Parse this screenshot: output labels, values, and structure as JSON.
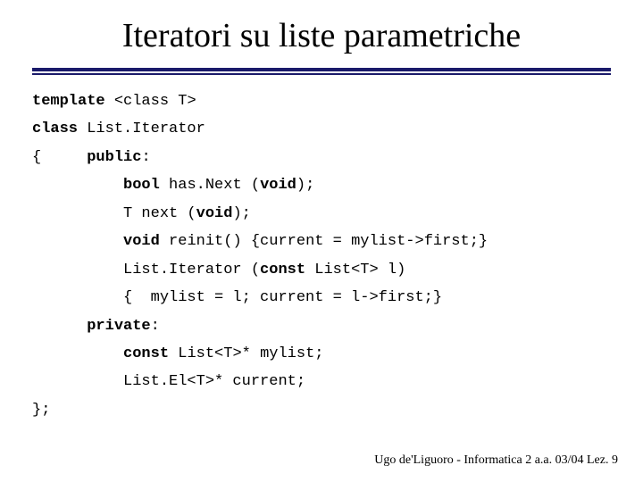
{
  "title": "Iteratori su liste parametriche",
  "code": {
    "l1a": "template",
    "l1b": " <class T>",
    "l2a": "class",
    "l2b": " List.Iterator",
    "l3a": "{     ",
    "l3b": "public",
    "l3c": ":",
    "l4a": "          ",
    "l4b": "bool",
    "l4c": " has.Next (",
    "l4d": "void",
    "l4e": ");",
    "l5a": "          T next (",
    "l5b": "void",
    "l5c": ");",
    "l6a": "          ",
    "l6b": "void",
    "l6c": " reinit() {current = mylist->first;}",
    "l7a": "          List.Iterator (",
    "l7b": "const",
    "l7c": " List<T> l)",
    "l8": "          {  mylist = l; current = l->first;}",
    "l9a": "      ",
    "l9b": "private",
    "l9c": ":",
    "l10a": "          ",
    "l10b": "const",
    "l10c": " List<T>* mylist;",
    "l11": "          List.El<T>* current;",
    "l12": "};"
  },
  "footer": "Ugo de'Liguoro - Informatica 2 a.a. 03/04 Lez. 9"
}
